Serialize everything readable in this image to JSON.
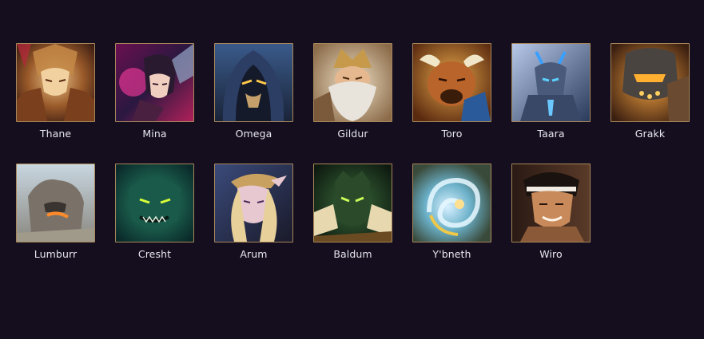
{
  "heroes_row1": [
    {
      "name": "Thane",
      "art": "thane-portrait"
    },
    {
      "name": "Mina",
      "art": "mina-portrait"
    },
    {
      "name": "Omega",
      "art": "omega-portrait"
    },
    {
      "name": "Gildur",
      "art": "gildur-portrait"
    },
    {
      "name": "Toro",
      "art": "toro-portrait"
    },
    {
      "name": "Taara",
      "art": "taara-portrait"
    },
    {
      "name": "Grakk",
      "art": "grakk-portrait"
    }
  ],
  "heroes_row2": [
    {
      "name": "Lumburr",
      "art": "lumburr-portrait"
    },
    {
      "name": "Cresht",
      "art": "cresht-portrait"
    },
    {
      "name": "Arum",
      "art": "arum-portrait"
    },
    {
      "name": "Baldum",
      "art": "baldum-portrait"
    },
    {
      "name": "Y'bneth",
      "art": "ybneth-portrait"
    },
    {
      "name": "Wiro",
      "art": "wiro-portrait"
    }
  ],
  "colors": {
    "background": "#140e1e",
    "frame": "#a8875a",
    "label": "#e8e6ee"
  }
}
